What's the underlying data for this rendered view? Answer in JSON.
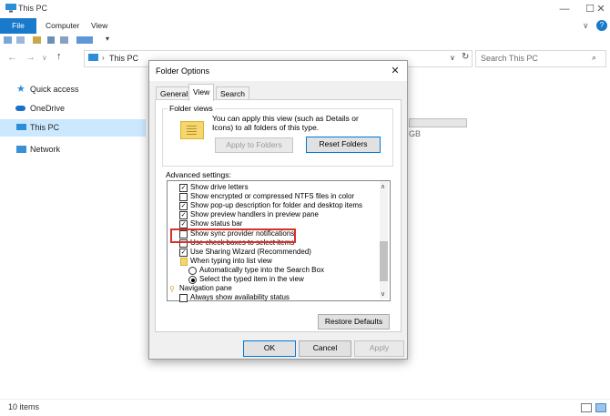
{
  "window": {
    "title": "This PC",
    "minimize": "—",
    "maximize": "☐",
    "close": "✕"
  },
  "ribbon": {
    "tabs": [
      "File",
      "Computer",
      "View"
    ]
  },
  "address": {
    "breadcrumb": "This PC",
    "search_placeholder": "Search This PC"
  },
  "nav_pane": {
    "items": [
      {
        "label": "Quick access",
        "icon": "star-icon"
      },
      {
        "label": "OneDrive",
        "icon": "cloud-icon"
      },
      {
        "label": "This PC",
        "icon": "computer-icon",
        "selected": true
      },
      {
        "label": "Network",
        "icon": "network-icon"
      }
    ]
  },
  "content": {
    "drive_size_fragment": "GB"
  },
  "status": {
    "item_count": "10 items"
  },
  "dialog": {
    "title": "Folder Options",
    "tabs": [
      "General",
      "View",
      "Search"
    ],
    "active_tab": "View",
    "folder_views": {
      "label": "Folder views",
      "description": "You can apply this view (such as Details or Icons) to all folders of this type.",
      "apply_button": "Apply to Folders",
      "reset_button": "Reset Folders"
    },
    "advanced_label": "Advanced settings:",
    "advanced_items": [
      {
        "type": "checkbox",
        "label": "Show drive letters",
        "checked": true,
        "indent": 1
      },
      {
        "type": "checkbox",
        "label": "Show encrypted or compressed NTFS files in color",
        "checked": false,
        "indent": 1
      },
      {
        "type": "checkbox",
        "label": "Show pop-up description for folder and desktop items",
        "checked": true,
        "indent": 1
      },
      {
        "type": "checkbox",
        "label": "Show preview handlers in preview pane",
        "checked": true,
        "indent": 1
      },
      {
        "type": "checkbox",
        "label": "Show status bar",
        "checked": true,
        "indent": 1
      },
      {
        "type": "checkbox",
        "label": "Show sync provider notifications",
        "checked": false,
        "indent": 1,
        "highlighted": true
      },
      {
        "type": "checkbox",
        "label": "Use check boxes to select items",
        "checked": false,
        "indent": 1
      },
      {
        "type": "checkbox",
        "label": "Use Sharing Wizard (Recommended)",
        "checked": true,
        "indent": 1
      },
      {
        "type": "folder",
        "label": "When typing into list view",
        "indent": 1
      },
      {
        "type": "radio",
        "label": "Automatically type into the Search Box",
        "checked": false,
        "indent": 2
      },
      {
        "type": "radio",
        "label": "Select the typed item in the view",
        "checked": true,
        "indent": 2
      },
      {
        "type": "group",
        "label": "Navigation pane",
        "indent": 0
      },
      {
        "type": "checkbox",
        "label": "Always show availability status",
        "checked": false,
        "indent": 1
      }
    ],
    "restore_defaults": "Restore Defaults",
    "ok": "OK",
    "cancel": "Cancel",
    "apply": "Apply"
  },
  "colors": {
    "accent": "#1979ca",
    "selection": "#cce8ff",
    "highlight_border": "#d9302b"
  }
}
